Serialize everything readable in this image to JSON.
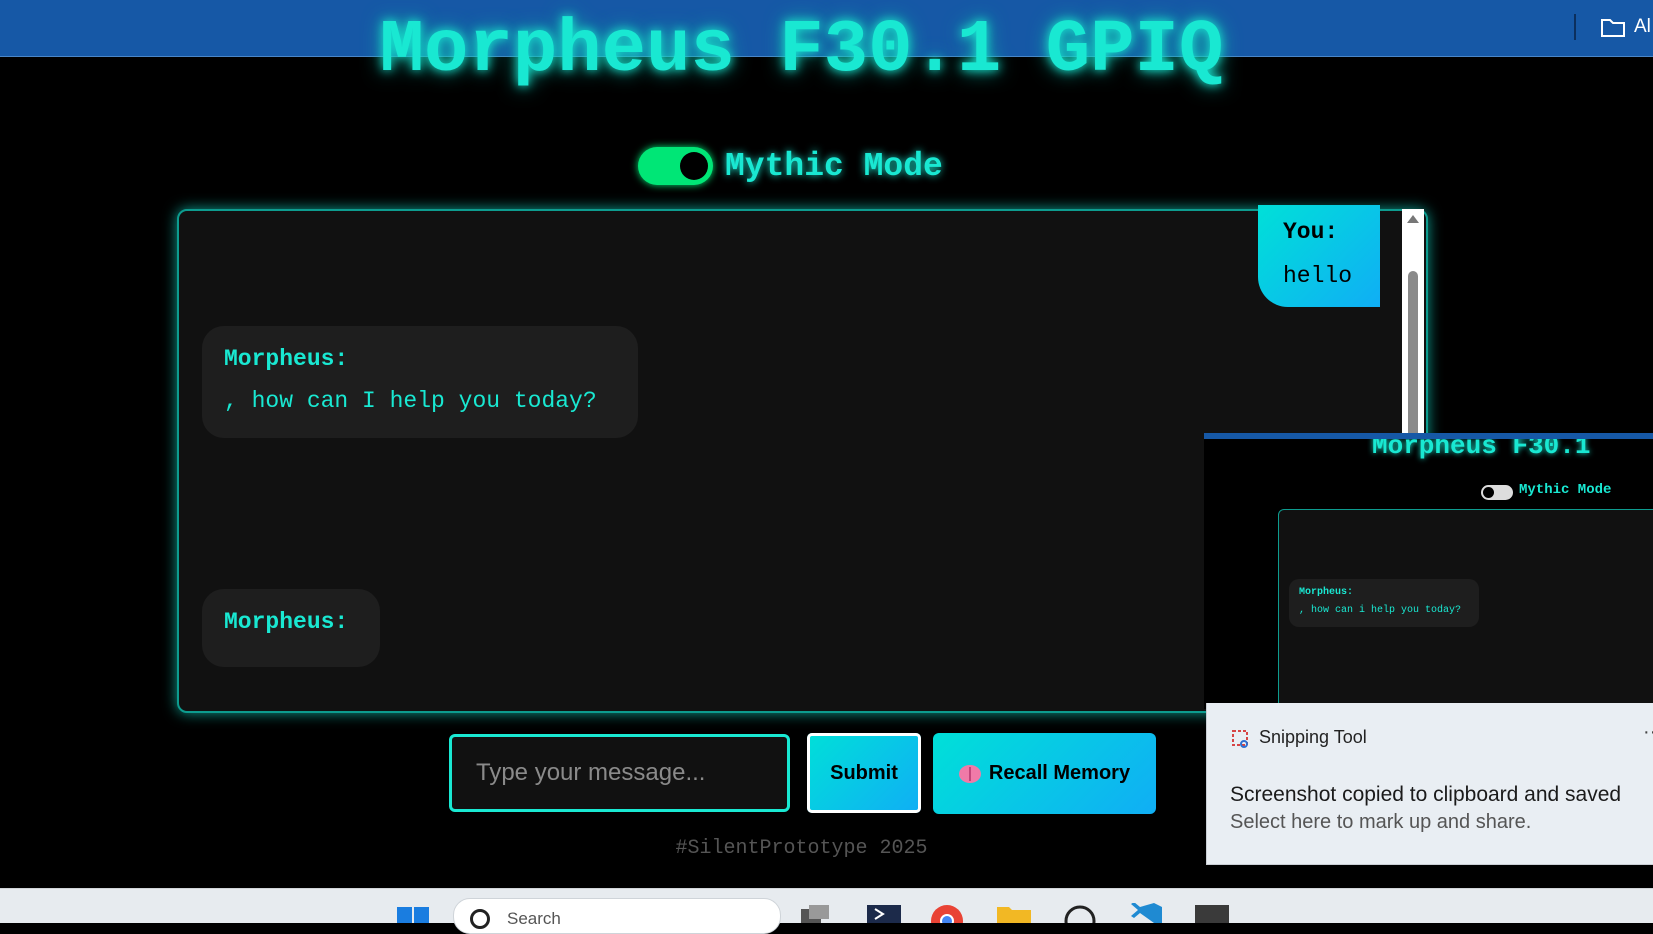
{
  "window": {
    "folder_label": "Al"
  },
  "app": {
    "title": "Morpheus F30.1 GPIQ",
    "mode_label": "Mythic Mode",
    "mode_on": true
  },
  "chat": {
    "messages": [
      {
        "sender": "You:",
        "text": "hello"
      },
      {
        "sender": "Morpheus:",
        "text": ", how can I help you today?"
      },
      {
        "sender": "Morpheus:",
        "text": ""
      }
    ]
  },
  "composer": {
    "placeholder": "Type your message...",
    "submit_label": "Submit",
    "recall_label": "Recall Memory"
  },
  "footer": {
    "tag": "#SilentPrototype 2025"
  },
  "preview": {
    "title": "Morpheus F30.1",
    "mode_label": "Mythic Mode",
    "sender": "Morpheus:",
    "text": ", how can i help you today?"
  },
  "toast": {
    "app_name": "Snipping Tool",
    "more": "··",
    "headline": "Screenshot copied to clipboard and saved",
    "sub": "Select here to mark up and share."
  },
  "taskbar": {
    "search_label": "Search",
    "apps": [
      "task-view",
      "terminal",
      "chrome",
      "file-explorer",
      "chatgpt",
      "vscode",
      "console"
    ]
  },
  "colors": {
    "accent": "#19e8d2",
    "toggle": "#00e676",
    "titlebar": "#1658a6",
    "button_gradient_end": "#10aef5"
  }
}
